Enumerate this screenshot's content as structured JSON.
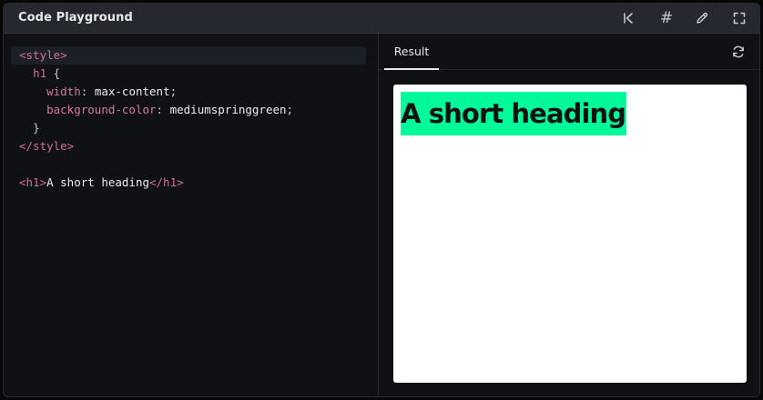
{
  "header": {
    "title": "Code Playground",
    "icons": [
      "reset-icon",
      "hash-icon",
      "pencil-icon",
      "fullscreen-icon"
    ],
    "hash_glyph": "#"
  },
  "editor": {
    "lines": [
      [
        {
          "t": "tag",
          "v": "<style>"
        }
      ],
      [
        {
          "t": "text",
          "v": "  "
        },
        {
          "t": "sel",
          "v": "h1"
        },
        {
          "t": "punc",
          "v": " {"
        }
      ],
      [
        {
          "t": "text",
          "v": "    "
        },
        {
          "t": "prop",
          "v": "width"
        },
        {
          "t": "punc",
          "v": ": "
        },
        {
          "t": "val",
          "v": "max-content"
        },
        {
          "t": "punc",
          "v": ";"
        }
      ],
      [
        {
          "t": "text",
          "v": "    "
        },
        {
          "t": "prop",
          "v": "background-color"
        },
        {
          "t": "punc",
          "v": ": "
        },
        {
          "t": "val",
          "v": "mediumspringgreen"
        },
        {
          "t": "punc",
          "v": ";"
        }
      ],
      [
        {
          "t": "text",
          "v": "  "
        },
        {
          "t": "punc",
          "v": "}"
        }
      ],
      [
        {
          "t": "tag",
          "v": "</style>"
        }
      ],
      [],
      [
        {
          "t": "tag",
          "v": "<h1>"
        },
        {
          "t": "text",
          "v": "A short heading"
        },
        {
          "t": "tag",
          "v": "</h1>"
        }
      ]
    ],
    "active_line": 0
  },
  "result": {
    "tab_label": "Result",
    "heading": "A short heading"
  },
  "colors": {
    "header_bg": "#25282e",
    "editor_bg": "#0f1115",
    "tag_color": "#d36d99",
    "heading_highlight": "#00fa9a"
  }
}
